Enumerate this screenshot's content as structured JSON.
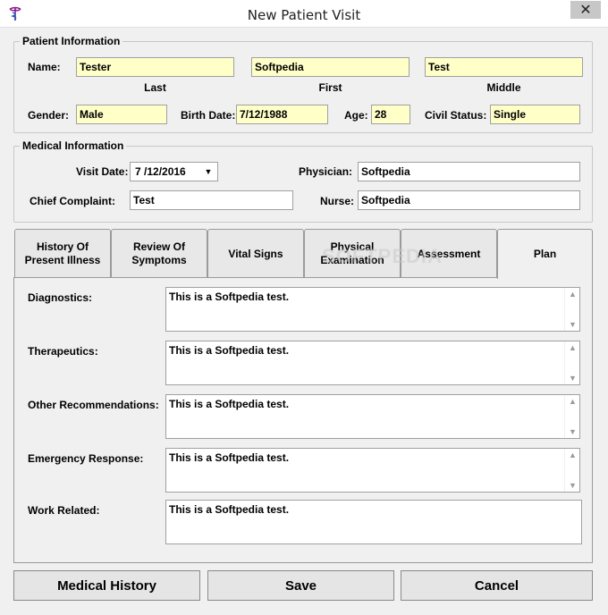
{
  "window": {
    "title": "New Patient Visit",
    "close_glyph": "✕"
  },
  "patient_info": {
    "legend": "Patient Information",
    "name_label": "Name:",
    "last": "Tester",
    "first": "Softpedia",
    "middle": "Test",
    "last_caption": "Last",
    "first_caption": "First",
    "middle_caption": "Middle",
    "gender_label": "Gender:",
    "gender": "Male",
    "birth_label": "Birth Date:",
    "birth_date": "7/12/1988",
    "age_label": "Age:",
    "age": "28",
    "civil_label": "Civil Status:",
    "civil_status": "Single"
  },
  "medical_info": {
    "legend": "Medical Information",
    "visit_date_label": "Visit Date:",
    "visit_date": "7 /12/2016",
    "physician_label": "Physician:",
    "physician": "Softpedia",
    "chief_label": "Chief Complaint:",
    "chief_complaint": "Test",
    "nurse_label": "Nurse:",
    "nurse": "Softpedia"
  },
  "tabs": [
    {
      "line1": "History Of",
      "line2": "Present Illness"
    },
    {
      "line1": "Review Of",
      "line2": "Symptoms"
    },
    {
      "line1": "Vital Signs",
      "line2": ""
    },
    {
      "line1": "Physical",
      "line2": "Examination"
    },
    {
      "line1": "Assessment",
      "line2": ""
    },
    {
      "line1": "Plan",
      "line2": ""
    }
  ],
  "active_tab": "Plan",
  "plan": {
    "diagnostics_label": "Diagnostics:",
    "diagnostics": "This is a Softpedia test.",
    "therapeutics_label": "Therapeutics:",
    "therapeutics": "This is a Softpedia test.",
    "other_label": "Other Recommendations:",
    "other": "This is a Softpedia test.",
    "emergency_label": "Emergency Response:",
    "emergency": "This is a Softpedia test.",
    "work_label": "Work Related:",
    "work": "This is a Softpedia test."
  },
  "buttons": {
    "history": "Medical History",
    "save": "Save",
    "cancel": "Cancel"
  },
  "watermark": "SOFTPEDIA",
  "colors": {
    "required_field": "#ffffc8",
    "background": "#f0f0f0",
    "icon": "#8b1a8b"
  }
}
